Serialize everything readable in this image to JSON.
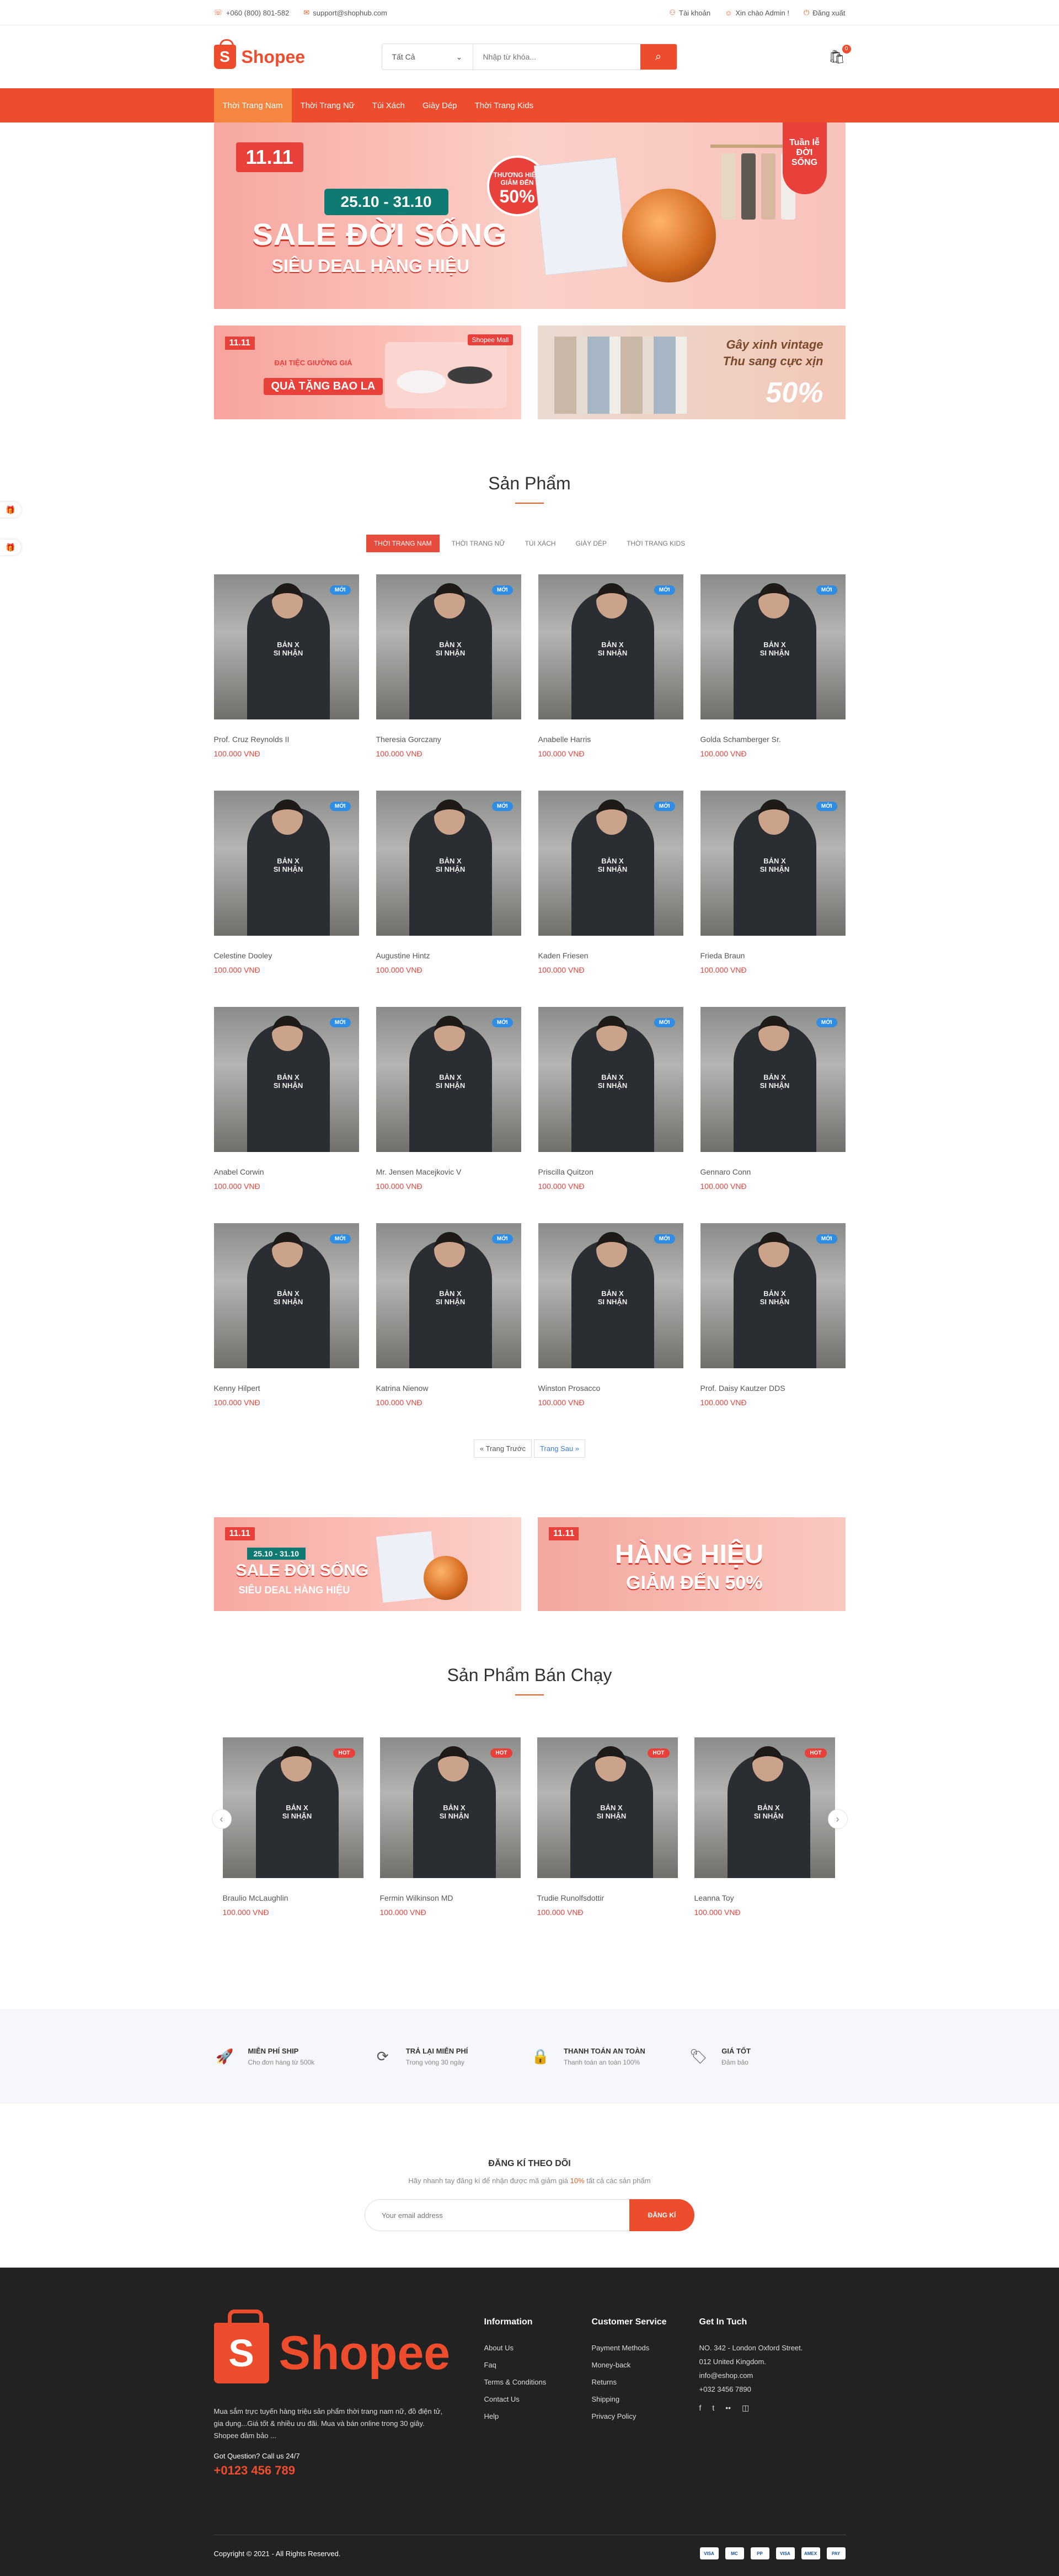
{
  "topbar": {
    "phone": "+060 (800) 801-582",
    "email": "support@shophub.com",
    "account": "Tài khoản",
    "greeting": "Xin chào Admin !",
    "logout": "Đăng xuất"
  },
  "header": {
    "logo": "Shopee",
    "search_category": "Tất Cả",
    "search_placeholder": "Nhập từ khóa...",
    "cart_count": "0"
  },
  "nav": [
    "Thời Trang Nam",
    "Thời Trang Nữ",
    "Túi Xách",
    "Giày Dép",
    "Thời Trang Kids"
  ],
  "hero": {
    "badge": "11.11",
    "date": "25.10 - 31.10",
    "title": "SALE ĐỜI SỐNG",
    "subtitle": "SIÊU DEAL HÀNG HIỆU",
    "circle_top": "THƯƠNG HIỆU GIẢM ĐẾN",
    "circle_big": "50%",
    "flag": "Tuần lễ ĐỜI SỐNG"
  },
  "banner_small": {
    "b1_tag": "11.11",
    "b1_line1": "QUÀ TẶNG BAO LA",
    "b1_small": "ĐẠI TIỆC GIƯỜNG GIÁ",
    "b1_shop": "Shopee Mall",
    "b2_line1": "Gây xinh vintage",
    "b2_line2": "Thu sang cực xịn",
    "b2_big": "50%"
  },
  "products_section": {
    "title": "Sản Phẩm",
    "tabs": [
      "Thời trang nam",
      "Thời trang nữ",
      "Túi xách",
      "Giày dép",
      "Thời trang kids"
    ],
    "badge": "MỚI",
    "price": "100.000 VNĐ",
    "items": [
      "Prof. Cruz Reynolds II",
      "Theresia Gorczany",
      "Anabelle Harris",
      "Golda Schamberger Sr.",
      "Celestine Dooley",
      "Augustine Hintz",
      "Kaden Friesen",
      "Frieda Braun",
      "Anabel Corwin",
      "Mr. Jensen Macejkovic V",
      "Priscilla Quitzon",
      "Gennaro Conn",
      "Kenny Hilpert",
      "Katrina Nienow",
      "Winston Prosacco",
      "Prof. Daisy Kautzer DDS"
    ],
    "prev": "« Trang Trước",
    "next": "Trang Sau »"
  },
  "banner_mid": {
    "b3_tag": "11.11",
    "b3_date": "25.10 - 31.10",
    "b3_title": "SALE ĐỜI SỐNG",
    "b3_sub": "SIÊU DEAL HÀNG HIỆU",
    "b4_tag": "11.11",
    "b4_title": "HÀNG HIỆU",
    "b4_sub": "GIẢM ĐẾN 50%"
  },
  "best_section": {
    "title": "Sản Phẩm Bán Chạy",
    "badge": "HOT",
    "price": "100.000 VNĐ",
    "items": [
      "Braulio McLaughlin",
      "Fermin Wilkinson MD",
      "Trudie Runolfsdottir",
      "Leanna Toy"
    ]
  },
  "features": [
    {
      "title": "Miễn phí ship",
      "sub": "Cho đơn hàng từ 500k",
      "icon": "rocket-icon"
    },
    {
      "title": "Trả lại miễn phí",
      "sub": "Trong vòng 30 ngày",
      "icon": "refresh-icon"
    },
    {
      "title": "Thanh toán an toàn",
      "sub": "Thanh toán an toàn 100%",
      "icon": "lock-icon"
    },
    {
      "title": "Giá tốt",
      "sub": "Đảm bảo",
      "icon": "tag-icon"
    }
  ],
  "newsletter": {
    "title": "Đăng kí theo dõi",
    "text_before": "Hãy nhanh tay đăng kí để nhận được mã giảm giá ",
    "highlight": "10%",
    "text_after": " tất cả các sản phẩm",
    "placeholder": "Your email address",
    "button": "ĐĂNG KÍ"
  },
  "footer": {
    "logo": "Shopee",
    "about": "Mua sắm trực tuyến hàng triệu sản phẩm thời trang nam nữ, đồ điện tử, gia dụng...Giá tốt & nhiều ưu đãi. Mua và bán online trong 30 giây. Shopee đảm bảo ...",
    "question": "Got Question? Call us 24/7",
    "phone": "+0123 456 789",
    "info_title": "Information",
    "info_links": [
      "About Us",
      "Faq",
      "Terms & Conditions",
      "Contact Us",
      "Help"
    ],
    "service_title": "Customer Service",
    "service_links": [
      "Payment Methods",
      "Money-back",
      "Returns",
      "Shipping",
      "Privacy Policy"
    ],
    "contact_title": "Get In Tuch",
    "contact_lines": [
      "NO. 342 - London Oxford Street.",
      "012 United Kingdom.",
      "info@eshop.com",
      "+032 3456 7890"
    ],
    "copyright": "Copyright © 2021 - All Rights Reserved.",
    "payments": [
      "VISA",
      "MC",
      "PP",
      "VISA",
      "AMEX",
      "PAY"
    ]
  }
}
